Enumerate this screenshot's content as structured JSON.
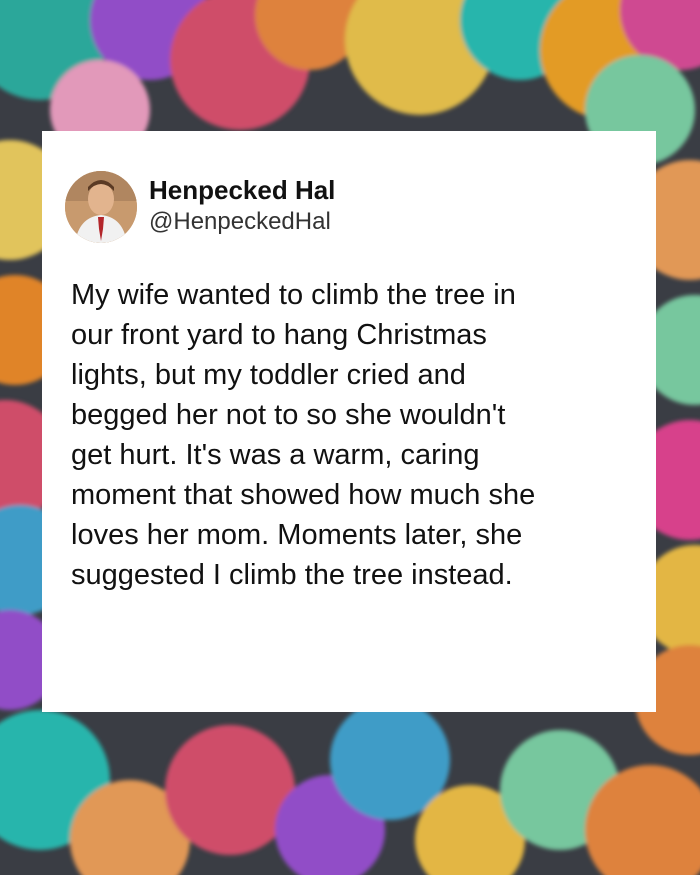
{
  "post": {
    "display_name": "Henpecked Hal",
    "handle": "@HenpeckedHal",
    "text": "My wife wanted to climb the tree in\nour front yard to hang Christmas\nlights, but my toddler cried and\nbegged her not to so she wouldn't\nget hurt. It's was a warm, caring\nmoment that showed how much she\nloves her mom. Moments later, she\nsuggested I climb the tree instead."
  },
  "colors": {
    "background": "#3a3d44",
    "card": "#ffffff",
    "text": "#111111"
  }
}
